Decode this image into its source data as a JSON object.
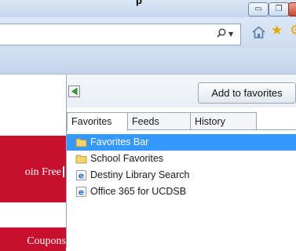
{
  "window": {
    "title_fragment": "p",
    "min_symbol": "▭",
    "restore_symbol": "❐"
  },
  "address_bar": {
    "search_icon": "search-icon",
    "dropdown_symbol": "▼"
  },
  "toolbar": {
    "home_icon": "home-icon",
    "favorites_icon": "star-icon"
  },
  "webpage": {
    "join_text": "oin Free",
    "coupon_text": "Coupons",
    "brand_color": "#c8102e"
  },
  "favorites_center": {
    "add_button_label": "Add to favorites",
    "pin_icon": "pin-green-arrow-icon",
    "tabs": [
      {
        "label": "Favorites",
        "active": true
      },
      {
        "label": "Feeds",
        "active": false
      },
      {
        "label": "History",
        "active": false
      }
    ],
    "items": [
      {
        "label": "Favorites Bar",
        "icon": "folder-icon",
        "selected": true
      },
      {
        "label": "School Favorites",
        "icon": "folder-icon",
        "selected": false
      },
      {
        "label": "Destiny Library Search",
        "icon": "ie-page-icon",
        "selected": false
      },
      {
        "label": "Office 365 for UCDSB",
        "icon": "ie-page-icon",
        "selected": false
      }
    ],
    "selection_color": "#3399ff"
  }
}
